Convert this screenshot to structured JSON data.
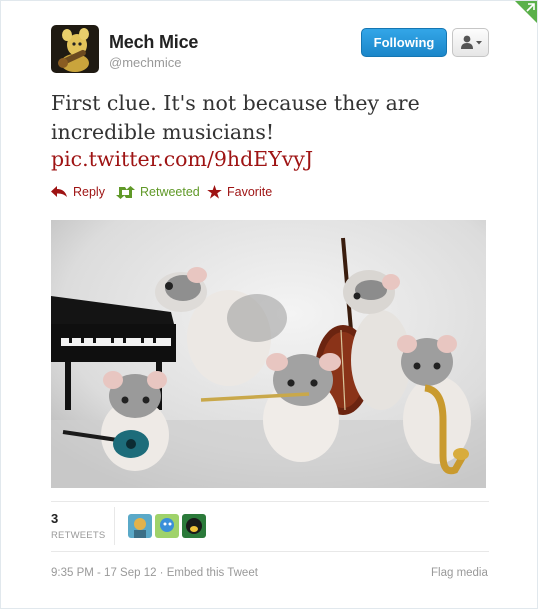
{
  "user": {
    "display_name": "Mech Mice",
    "screen_name": "@mechmice",
    "avatar_icon": "mouse-guitarist-avatar"
  },
  "controls": {
    "follow_label": "Following",
    "user_dropdown_icon": "user-chevron-icon"
  },
  "tweet": {
    "text": "First clue. It's not because they are incredible musicians!",
    "link": "pic.twitter.com/9hdEYvyJ"
  },
  "actions": {
    "reply": "Reply",
    "retweet": "Retweeted",
    "favorite": "Favorite"
  },
  "stats": {
    "retweet_count": "3",
    "retweet_label": "RETWEETS"
  },
  "meta": {
    "time": "9:35 PM - 17 Sep 12",
    "separator": " · ",
    "embed": "Embed this Tweet",
    "flag": "Flag media"
  },
  "colors": {
    "link": "#9e1313",
    "retweet": "#609928",
    "follow_button": "#2a96da"
  }
}
